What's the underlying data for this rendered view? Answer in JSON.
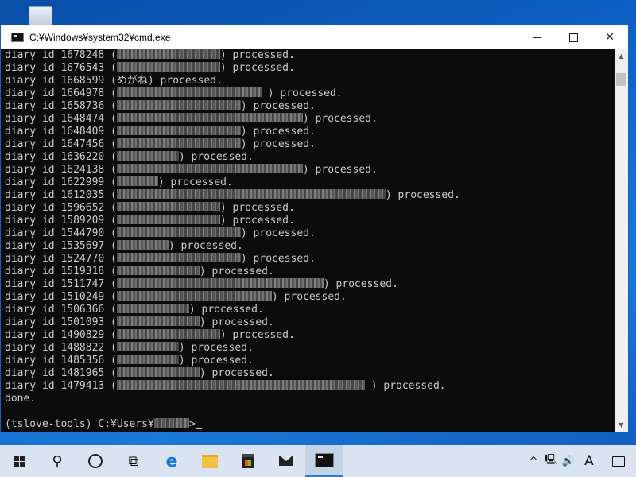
{
  "window": {
    "title": "C:¥Windows¥system32¥cmd.exe",
    "close_glyph": "✕"
  },
  "console": {
    "processed_word": "processed.",
    "lines": [
      {
        "prefix": "diary id 1678248 (",
        "visible": "",
        "redacted_chars": 10,
        "suffix": ") processed."
      },
      {
        "prefix": "diary id 1676543 (",
        "visible": "",
        "redacted_chars": 10,
        "suffix": ") processed."
      },
      {
        "prefix": "diary id 1668599 (",
        "visible": "めがね",
        "redacted_chars": 0,
        "suffix": ") processed."
      },
      {
        "prefix": "diary id 1664978 (",
        "visible": "",
        "redacted_chars": 14,
        "suffix": " ) processed."
      },
      {
        "prefix": "diary id 1658736 (",
        "visible": "",
        "redacted_chars": 12,
        "suffix": ") processed."
      },
      {
        "prefix": "diary id 1648474 (",
        "visible": "",
        "redacted_chars": 18,
        "suffix": ") processed."
      },
      {
        "prefix": "diary id 1648409 (",
        "visible": "",
        "redacted_chars": 12,
        "suffix": ") processed."
      },
      {
        "prefix": "diary id 1647456 (",
        "visible": "",
        "redacted_chars": 12,
        "suffix": ") processed."
      },
      {
        "prefix": "diary id 1636220 (",
        "visible": "",
        "redacted_chars": 6,
        "suffix": ") processed."
      },
      {
        "prefix": "diary id 1624138 (",
        "visible": "",
        "redacted_chars": 18,
        "suffix": ") processed."
      },
      {
        "prefix": "diary id 1622999 (",
        "visible": "",
        "redacted_chars": 4,
        "suffix": ") processed."
      },
      {
        "prefix": "diary id 1612035 (",
        "visible": "",
        "redacted_chars": 26,
        "suffix": ") processed."
      },
      {
        "prefix": "diary id 1596652 (",
        "visible": "",
        "redacted_chars": 10,
        "suffix": ") processed."
      },
      {
        "prefix": "diary id 1589209 (",
        "visible": "",
        "redacted_chars": 10,
        "suffix": ") processed."
      },
      {
        "prefix": "diary id 1544790 (",
        "visible": "",
        "redacted_chars": 12,
        "suffix": ") processed."
      },
      {
        "prefix": "diary id 1535697 (",
        "visible": "",
        "redacted_chars": 5,
        "suffix": ") processed."
      },
      {
        "prefix": "diary id 1524770 (",
        "visible": "",
        "redacted_chars": 12,
        "suffix": ") processed."
      },
      {
        "prefix": "diary id 1519318 (",
        "visible": "",
        "redacted_chars": 8,
        "suffix": ") processed."
      },
      {
        "prefix": "diary id 1511747 (",
        "visible": "",
        "redacted_chars": 20,
        "suffix": ") processed."
      },
      {
        "prefix": "diary id 1510249 (",
        "visible": "",
        "redacted_chars": 15,
        "suffix": ") processed."
      },
      {
        "prefix": "diary id 1506366 (",
        "visible": "",
        "redacted_chars": 7,
        "suffix": ") processed."
      },
      {
        "prefix": "diary id 1501093 (",
        "visible": "",
        "redacted_chars": 8,
        "suffix": ") processed."
      },
      {
        "prefix": "diary id 1490829 (",
        "visible": "",
        "redacted_chars": 10,
        "suffix": ") processed."
      },
      {
        "prefix": "diary id 1488822 (",
        "visible": "",
        "redacted_chars": 6,
        "suffix": ") processed."
      },
      {
        "prefix": "diary id 1485356 (",
        "visible": "",
        "redacted_chars": 6,
        "suffix": ") processed."
      },
      {
        "prefix": "diary id 1481965 (",
        "visible": "",
        "redacted_chars": 8,
        "suffix": ") processed."
      },
      {
        "prefix": "diary id 1479413 (",
        "visible": "",
        "redacted_chars": 24,
        "suffix": " ) processed."
      }
    ],
    "done": "done.",
    "prompt_prefix": "(tslove-tools) C:¥Users¥",
    "prompt_suffix": ">"
  },
  "taskbar": {
    "ime_label": "A",
    "items": [
      "start-icon",
      "search-icon",
      "cortana-icon",
      "task-view-icon",
      "edge-icon",
      "file-explorer-icon",
      "store-icon",
      "mail-icon",
      "cmd-icon"
    ],
    "tray": [
      "chevron-up-icon",
      "network-icon",
      "volume-icon",
      "ime-icon",
      "notification-icon"
    ]
  }
}
